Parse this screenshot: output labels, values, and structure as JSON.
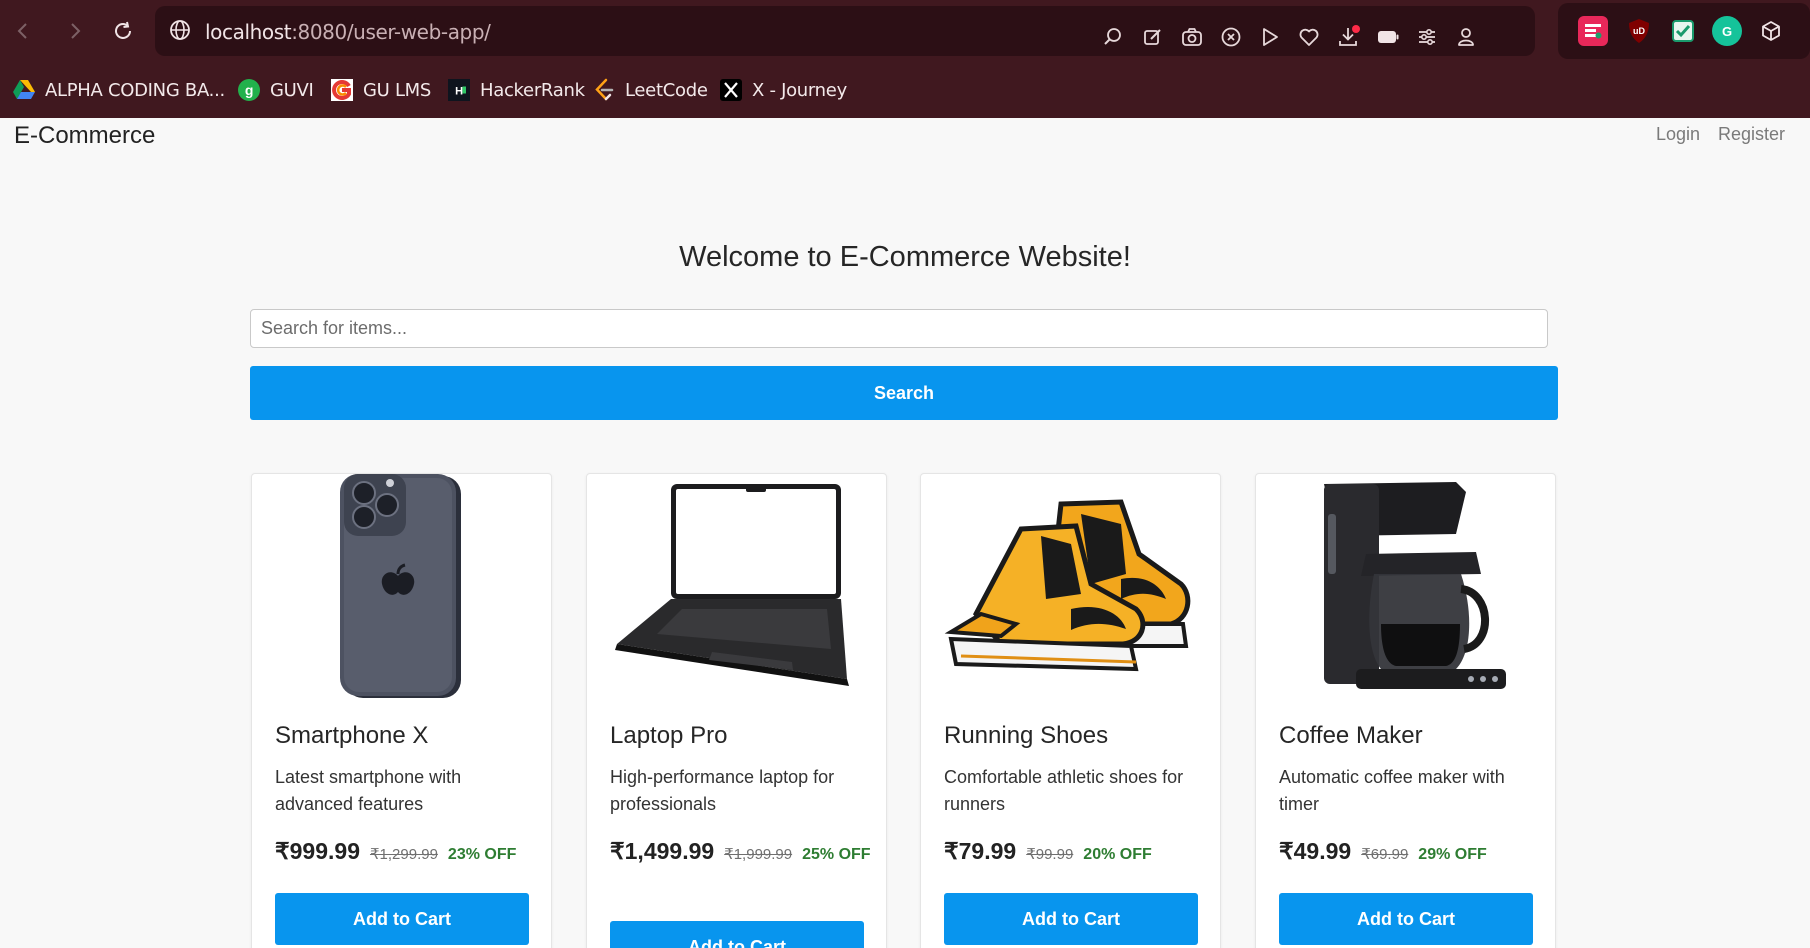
{
  "browser": {
    "url_host": "localhost",
    "url_rest": ":8080/user-web-app/",
    "bookmarks": [
      {
        "label": "ALPHA CODING BA...",
        "icon": "google-drive-icon"
      },
      {
        "label": "GUVI",
        "icon": "guvi-icon"
      },
      {
        "label": "GU LMS",
        "icon": "gu-lms-icon"
      },
      {
        "label": "HackerRank",
        "icon": "hackerrank-icon"
      },
      {
        "label": "LeetCode",
        "icon": "leetcode-icon"
      },
      {
        "label": "X - Journey",
        "icon": "x-icon"
      }
    ],
    "extensions": [
      {
        "name": "opera-gx-extension-icon",
        "color": "#e8285a"
      },
      {
        "name": "ublock-origin-icon",
        "color": "#800000",
        "label": "uD"
      },
      {
        "name": "checklist-extension-icon",
        "color": "#1a9a6c"
      },
      {
        "name": "grammarly-icon",
        "color": "#15c39a",
        "label": "G"
      },
      {
        "name": "extensions-cube-icon",
        "color": "#ffffff"
      }
    ]
  },
  "site": {
    "brand": "E-Commerce",
    "nav": {
      "login": "Login",
      "register": "Register"
    },
    "welcome": "Welcome to E-Commerce Website!",
    "search": {
      "placeholder": "Search for items...",
      "value": "",
      "button": "Search"
    },
    "products": [
      {
        "name": "Smartphone X",
        "description": "Latest smartphone with advanced features",
        "price": "₹999.99",
        "original_price": "₹1,299.99",
        "discount": "23% OFF",
        "button": "Add to Cart",
        "image": "smartphone-image"
      },
      {
        "name": "Laptop Pro",
        "description": "High-performance laptop for professionals",
        "price": "₹1,499.99",
        "original_price": "₹1,999.99",
        "discount": "25% OFF",
        "button": "Add to Cart",
        "image": "laptop-image"
      },
      {
        "name": "Running Shoes",
        "description": "Comfortable athletic shoes for runners",
        "price": "₹79.99",
        "original_price": "₹99.99",
        "discount": "20% OFF",
        "button": "Add to Cart",
        "image": "shoes-image"
      },
      {
        "name": "Coffee Maker",
        "description": "Automatic coffee maker with timer",
        "price": "₹49.99",
        "original_price": "₹69.99",
        "discount": "29% OFF",
        "button": "Add to Cart",
        "image": "coffee-maker-image"
      }
    ]
  },
  "colors": {
    "chrome": "#40181f",
    "primary_button": "#0895ee",
    "discount": "#2e7d32"
  }
}
